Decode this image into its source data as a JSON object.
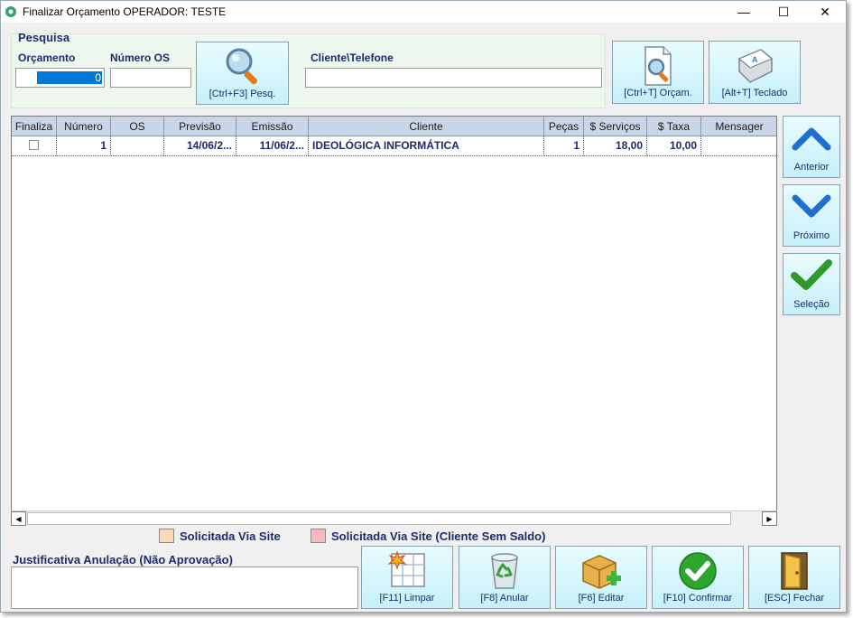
{
  "window": {
    "title": "Finalizar Orçamento OPERADOR: TESTE",
    "minimize": "—",
    "maximize": "☐",
    "close": "✕"
  },
  "search": {
    "group_title": "Pesquisa",
    "orcamento_label": "Orçamento",
    "orcamento_value": "0",
    "numero_os_label": "Número OS",
    "numero_os_value": "",
    "cliente_label": "Cliente\\Telefone",
    "cliente_value": "",
    "search_button": "[Ctrl+F3] Pesq.",
    "orcam_button": "[Ctrl+T] Orçam.",
    "teclado_button": "[Alt+T] Teclado"
  },
  "grid": {
    "columns": [
      "Finaliza",
      "Número",
      "OS",
      "Previsão",
      "Emissão",
      "Cliente",
      "Peças",
      "$ Serviços",
      "$ Taxa",
      "Mensager"
    ],
    "rows": [
      {
        "finaliza": "",
        "numero": "1",
        "os": "",
        "previsao": "14/06/2...",
        "emissao": "11/06/2...",
        "cliente": "IDEOLÓGICA INFORMÁTICA",
        "pecas": "1",
        "servicos": "18,00",
        "taxa": "10,00",
        "mensagem": ""
      }
    ]
  },
  "side": {
    "anterior": "Anterior",
    "proximo": "Próximo",
    "selecao": "Seleção"
  },
  "legend": {
    "site": "Solicitada Via Site",
    "site_color": "#fbd9b4",
    "site_sem_saldo": "Solicitada Via Site (Cliente Sem Saldo)",
    "site_sem_saldo_color": "#f7b8be"
  },
  "justificativa": {
    "label": "Justificativa Anulação (Não Aprovação)",
    "value": ""
  },
  "bottom": {
    "limpar": "[F11] Limpar",
    "anular": "[F8] Anular",
    "editar": "[F6] Editar",
    "confirmar": "[F10] Confirmar",
    "fechar": "[ESC] Fechar"
  },
  "colors": {
    "label_blue": "#1a2c6e",
    "header_bg": "#c9d6e8",
    "button_bg": "#c6f0fa",
    "selection": "#0078d7"
  }
}
